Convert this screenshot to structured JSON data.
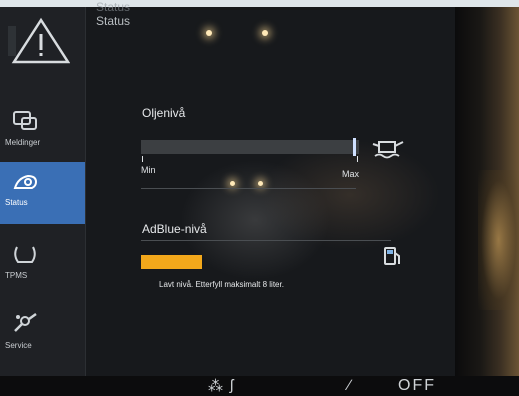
{
  "header": {
    "title": "Status",
    "subtitle": "Status"
  },
  "sidebar": {
    "items": [
      {
        "label": "Meldinger",
        "icon": "message-icon",
        "active": false
      },
      {
        "label": "Status",
        "icon": "car-status-icon",
        "active": true
      },
      {
        "label": "TPMS",
        "icon": "tire-pressure-icon",
        "active": false
      },
      {
        "label": "Service",
        "icon": "wrench-icon",
        "active": false
      }
    ]
  },
  "oil": {
    "title": "Oljenivå",
    "min_label": "Min",
    "max_label": "Max",
    "level_fraction": 0.98,
    "icon": "oil-can-icon"
  },
  "adblue": {
    "title": "AdBlue-nivå",
    "level_fraction": 0.28,
    "bar_color": "#f3a81b",
    "note": "Lavt nivå. Etterfyll maksimalt 8 liter.",
    "icon": "fuel-pump-icon"
  },
  "bottom_bar": {
    "off_label": "OFF"
  },
  "colors": {
    "active_nav": "#3a6fb5",
    "warning": "#f3a81b",
    "screen_bg": "#17191c"
  }
}
